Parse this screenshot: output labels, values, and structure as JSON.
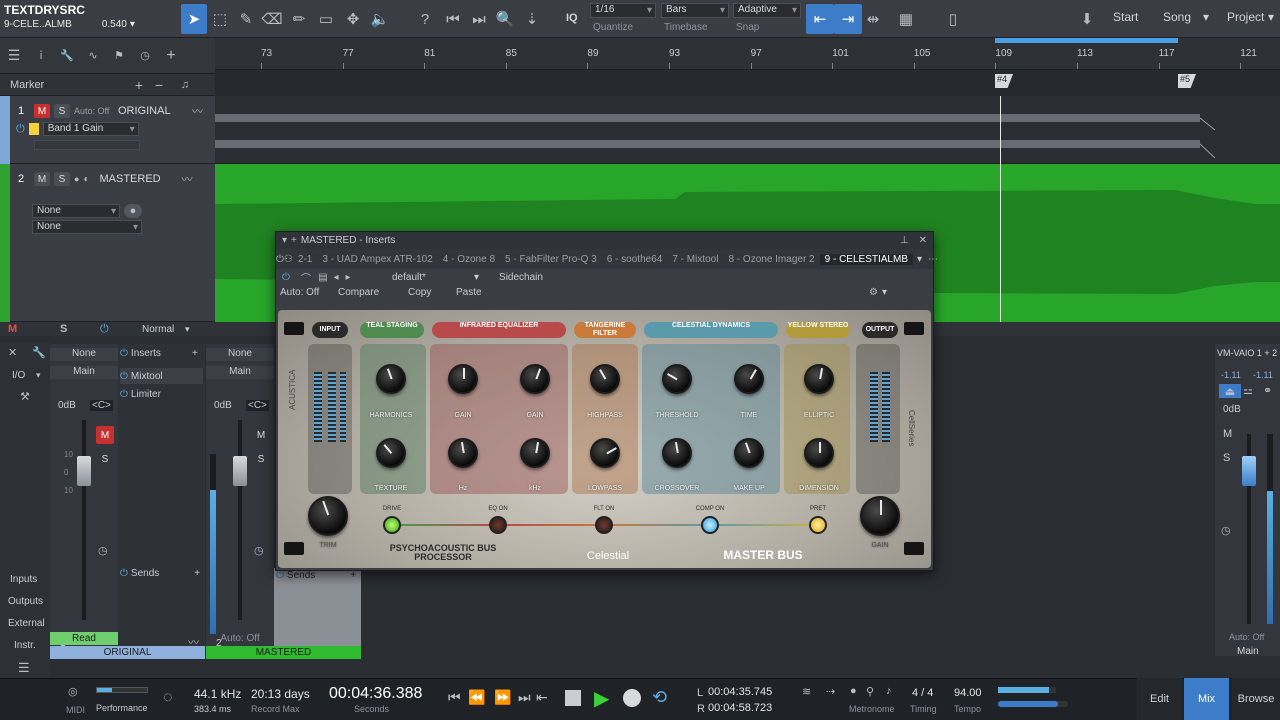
{
  "toolbar": {
    "song_title": "TEXTDRYSRC",
    "track_name": "9-CELE..ALMB",
    "value": "0.540",
    "quantize_value": "1/16",
    "quantize_label": "Quantize",
    "timebase_value": "Bars",
    "timebase_label": "Timebase",
    "snap_value": "Adaptive",
    "snap_label": "Snap",
    "iq": "IQ",
    "start": "Start",
    "song": "Song",
    "project": "Project"
  },
  "ruler": {
    "ticks": [
      "73",
      "77",
      "81",
      "85",
      "89",
      "93",
      "97",
      "101",
      "105",
      "109",
      "113",
      "117",
      "121"
    ],
    "markers": [
      "#4",
      "#5"
    ]
  },
  "marker_row": {
    "label": "Marker"
  },
  "tracks": [
    {
      "num": "1",
      "mute": "M",
      "solo": "S",
      "auto": "Auto: Off",
      "name": "ORIGINAL",
      "param": "Band 1 Gain"
    },
    {
      "num": "2",
      "mute": "M",
      "solo": "S",
      "name": "MASTERED",
      "sel1": "None",
      "sel2": "None"
    }
  ],
  "mixer": {
    "mode": "Normal",
    "io": "I/O",
    "none": "None",
    "main": "Main",
    "zero_db": "0dB",
    "pan": "<C>",
    "inserts": "Inserts",
    "insert_items": [
      "Mixtool",
      "Limiter"
    ],
    "sends": "Sends",
    "sends2": "Sends",
    "read": "Read",
    "auto_off": "Auto: Off",
    "num1": "1",
    "num2": "2",
    "ch1": "ORIGINAL",
    "ch2": "MASTERED",
    "left_nav": [
      "Inputs",
      "Outputs",
      "External",
      "Instr."
    ],
    "right_name": "VM-VAIO 1 + 2",
    "right_val1": "-1.11",
    "right_val2": "-1.11",
    "right_auto": "Auto: Off",
    "right_main": "Main",
    "m": "M",
    "s": "S"
  },
  "inserts": {
    "title": "MASTERED - Inserts",
    "tabs": [
      "2-1",
      "3 - UAD Ampex ATR-102",
      "4 - Ozone 8",
      "5 - FabFilter Pro-Q 3",
      "6 - soothe64",
      "7 - Mixtool",
      "8 - Ozone Imager 2",
      "9 - CELESTIALMB"
    ],
    "preset": "default*",
    "sidechain": "Sidechain",
    "auto_off": "Auto: Off",
    "compare": "Compare",
    "copy": "Copy",
    "paste": "Paste"
  },
  "plugin": {
    "sections": [
      "INPUT",
      "TEAL STAGING",
      "INFRARED EQUALIZER",
      "TANGERINE FILTER",
      "CELESTIAL DYNAMICS",
      "YELLOW STEREO",
      "OUTPUT"
    ],
    "knob_labels": [
      "HARMONICS",
      "GAIN",
      "GAIN",
      "HIGHPASS",
      "THRESHOLD",
      "TIME",
      "ELLIPTIC",
      "TEXTURE",
      "Hz",
      "kHz",
      "LOWPASS",
      "CROSSOVER",
      "MAKE UP",
      "DIMENSION",
      "TRIM",
      "GAIN"
    ],
    "leds": [
      "DRIVE",
      "EQ ON",
      "FLT ON",
      "COMP ON",
      "PRET"
    ],
    "brand": "Celestial",
    "name_left": "PSYCHOACOUSTIC BUS PROCESSOR",
    "name_right": "MASTER BUS",
    "side_brand": "ACUSTICA",
    "side_series": "CellSeries"
  },
  "transport": {
    "midi": "MIDI",
    "performance": "Performance",
    "sample_rate": "44.1 kHz",
    "latency": "383.4 ms",
    "record_days": "20:13 days",
    "record_label": "Record Max",
    "time": "00:04:36.388",
    "time_label": "Seconds",
    "loop_l": "00:04:35.745",
    "loop_r": "00:04:58.723",
    "l": "L",
    "r": "R",
    "metronome": "Metronome",
    "timing_val": "4 / 4",
    "timing_label": "Timing",
    "tempo_val": "94.00",
    "tempo_label": "Tempo",
    "edit": "Edit",
    "mix": "Mix",
    "browse": "Browse"
  }
}
